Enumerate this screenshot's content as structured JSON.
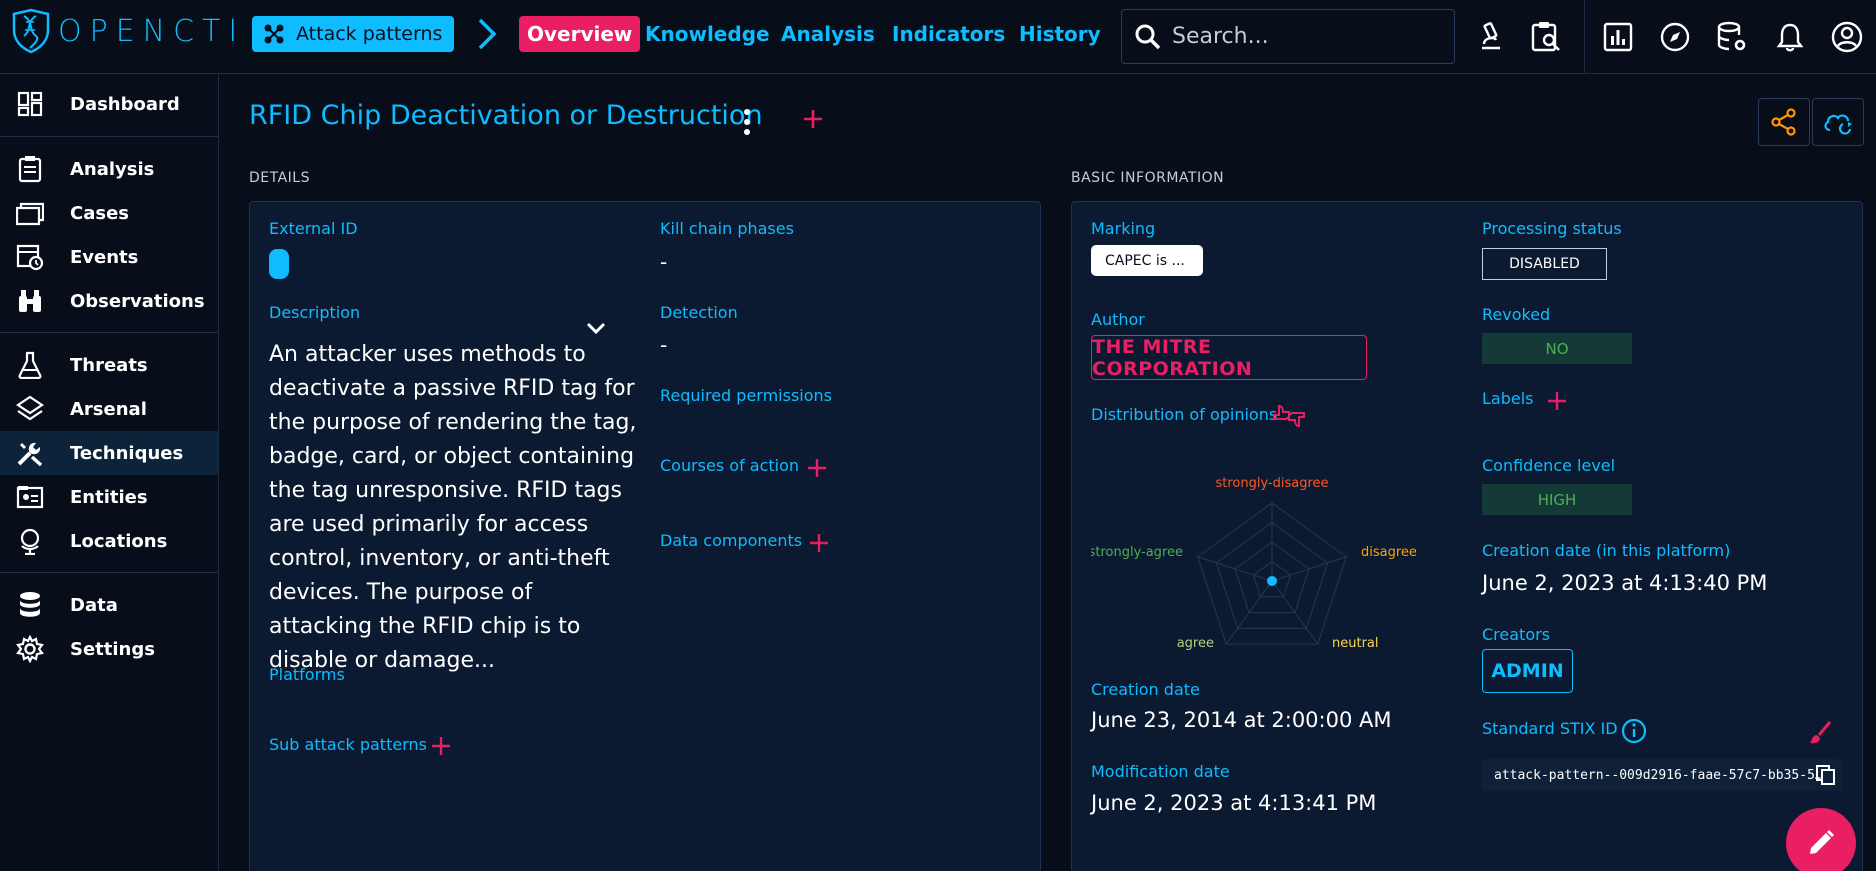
{
  "app": {
    "logo_text": "OPENCTI"
  },
  "header": {
    "entity_type": "Attack patterns",
    "tabs": [
      {
        "label": "Overview",
        "active": true
      },
      {
        "label": "Knowledge"
      },
      {
        "label": "Analysis"
      },
      {
        "label": "Indicators"
      },
      {
        "label": "History"
      }
    ],
    "search_placeholder": "Search..."
  },
  "sidebar": {
    "items": [
      {
        "label": "Dashboard",
        "icon": "dashboard-icon"
      },
      {
        "label": "Analysis",
        "icon": "clipboard-icon"
      },
      {
        "label": "Cases",
        "icon": "cases-icon"
      },
      {
        "label": "Events",
        "icon": "events-icon"
      },
      {
        "label": "Observations",
        "icon": "binoculars-icon"
      },
      {
        "label": "Threats",
        "icon": "flask-icon"
      },
      {
        "label": "Arsenal",
        "icon": "layers-icon"
      },
      {
        "label": "Techniques",
        "icon": "tools-icon",
        "active": true
      },
      {
        "label": "Entities",
        "icon": "entities-icon"
      },
      {
        "label": "Locations",
        "icon": "globe-icon"
      },
      {
        "label": "Data",
        "icon": "database-icon"
      },
      {
        "label": "Settings",
        "icon": "gear-icon"
      }
    ]
  },
  "page": {
    "title": "RFID Chip Deactivation or Destruction"
  },
  "details": {
    "section_title": "DETAILS",
    "external_id_label": "External ID",
    "description_label": "Description",
    "description": "An attacker uses methods to deactivate a passive RFID tag for the purpose of rendering the tag, badge, card, or object containing the tag unresponsive. RFID tags are used primarily for access control, inventory, or anti-theft devices. The purpose of attacking the RFID chip is to disable or damage...",
    "platforms_label": "Platforms",
    "sub_attack_patterns_label": "Sub attack patterns",
    "kill_chain_label": "Kill chain phases",
    "kill_chain_value": "-",
    "detection_label": "Detection",
    "detection_value": "-",
    "permissions_label": "Required permissions",
    "courses_label": "Courses of action",
    "data_components_label": "Data components"
  },
  "basic": {
    "section_title": "BASIC INFORMATION",
    "marking_label": "Marking",
    "marking_value": "CAPEC is ...",
    "author_label": "Author",
    "author_value": "THE MITRE CORPORATION",
    "opinions_label": "Distribution of opinions",
    "radar_labels": {
      "strongly_disagree": "strongly-disagree",
      "disagree": "disagree",
      "neutral": "neutral",
      "agree": "agree",
      "strongly_agree": "strongly-agree"
    },
    "radar_colors": {
      "strongly_disagree": "#ff5722",
      "disagree": "#ffa000",
      "neutral": "#ffd54f",
      "agree": "#aed581",
      "strongly_agree": "#4caf50"
    },
    "creation_date_label": "Creation date",
    "creation_date": "June 23, 2014 at 2:00:00 AM",
    "modification_date_label": "Modification date",
    "modification_date": "June 2, 2023 at 4:13:41 PM",
    "processing_label": "Processing status",
    "processing_value": "DISABLED",
    "revoked_label": "Revoked",
    "revoked_value": "NO",
    "labels_label": "Labels",
    "confidence_label": "Confidence level",
    "confidence_value": "HIGH",
    "platform_creation_label": "Creation date (in this platform)",
    "platform_creation_date": "June 2, 2023 at 4:13:40 PM",
    "creators_label": "Creators",
    "creator_value": "ADMIN",
    "stix_label": "Standard STIX ID",
    "stix_value": "attack-pattern--009d2916-faae-57c7-bb35-5…"
  },
  "colors": {
    "accent": "#0fbcff",
    "secondary": "#e91e63",
    "background": "#070d19",
    "card": "#0b1a30"
  }
}
